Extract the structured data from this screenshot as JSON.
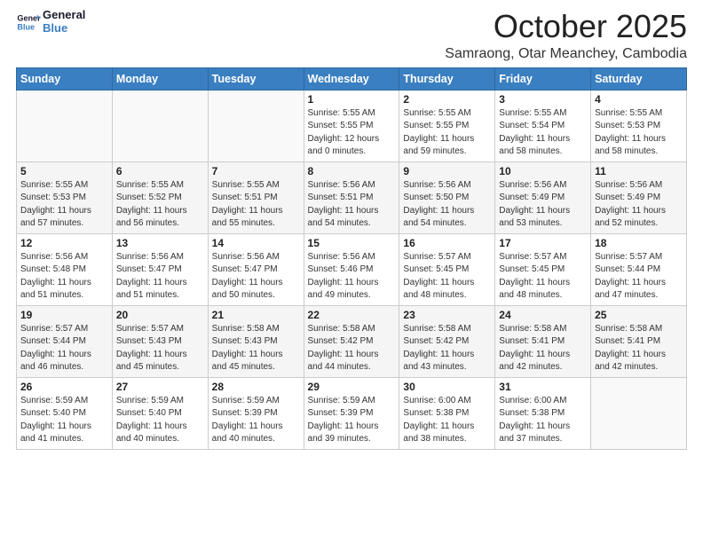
{
  "header": {
    "logo_line1": "General",
    "logo_line2": "Blue",
    "month": "October 2025",
    "location": "Samraong, Otar Meanchey, Cambodia"
  },
  "days_of_week": [
    "Sunday",
    "Monday",
    "Tuesday",
    "Wednesday",
    "Thursday",
    "Friday",
    "Saturday"
  ],
  "weeks": [
    [
      {
        "day": "",
        "sunrise": "",
        "sunset": "",
        "daylight": ""
      },
      {
        "day": "",
        "sunrise": "",
        "sunset": "",
        "daylight": ""
      },
      {
        "day": "",
        "sunrise": "",
        "sunset": "",
        "daylight": ""
      },
      {
        "day": "1",
        "sunrise": "5:55 AM",
        "sunset": "5:55 PM",
        "daylight": "12 hours and 0 minutes."
      },
      {
        "day": "2",
        "sunrise": "5:55 AM",
        "sunset": "5:55 PM",
        "daylight": "11 hours and 59 minutes."
      },
      {
        "day": "3",
        "sunrise": "5:55 AM",
        "sunset": "5:54 PM",
        "daylight": "11 hours and 58 minutes."
      },
      {
        "day": "4",
        "sunrise": "5:55 AM",
        "sunset": "5:53 PM",
        "daylight": "11 hours and 58 minutes."
      }
    ],
    [
      {
        "day": "5",
        "sunrise": "5:55 AM",
        "sunset": "5:53 PM",
        "daylight": "11 hours and 57 minutes."
      },
      {
        "day": "6",
        "sunrise": "5:55 AM",
        "sunset": "5:52 PM",
        "daylight": "11 hours and 56 minutes."
      },
      {
        "day": "7",
        "sunrise": "5:55 AM",
        "sunset": "5:51 PM",
        "daylight": "11 hours and 55 minutes."
      },
      {
        "day": "8",
        "sunrise": "5:56 AM",
        "sunset": "5:51 PM",
        "daylight": "11 hours and 54 minutes."
      },
      {
        "day": "9",
        "sunrise": "5:56 AM",
        "sunset": "5:50 PM",
        "daylight": "11 hours and 54 minutes."
      },
      {
        "day": "10",
        "sunrise": "5:56 AM",
        "sunset": "5:49 PM",
        "daylight": "11 hours and 53 minutes."
      },
      {
        "day": "11",
        "sunrise": "5:56 AM",
        "sunset": "5:49 PM",
        "daylight": "11 hours and 52 minutes."
      }
    ],
    [
      {
        "day": "12",
        "sunrise": "5:56 AM",
        "sunset": "5:48 PM",
        "daylight": "11 hours and 51 minutes."
      },
      {
        "day": "13",
        "sunrise": "5:56 AM",
        "sunset": "5:47 PM",
        "daylight": "11 hours and 51 minutes."
      },
      {
        "day": "14",
        "sunrise": "5:56 AM",
        "sunset": "5:47 PM",
        "daylight": "11 hours and 50 minutes."
      },
      {
        "day": "15",
        "sunrise": "5:56 AM",
        "sunset": "5:46 PM",
        "daylight": "11 hours and 49 minutes."
      },
      {
        "day": "16",
        "sunrise": "5:57 AM",
        "sunset": "5:45 PM",
        "daylight": "11 hours and 48 minutes."
      },
      {
        "day": "17",
        "sunrise": "5:57 AM",
        "sunset": "5:45 PM",
        "daylight": "11 hours and 48 minutes."
      },
      {
        "day": "18",
        "sunrise": "5:57 AM",
        "sunset": "5:44 PM",
        "daylight": "11 hours and 47 minutes."
      }
    ],
    [
      {
        "day": "19",
        "sunrise": "5:57 AM",
        "sunset": "5:44 PM",
        "daylight": "11 hours and 46 minutes."
      },
      {
        "day": "20",
        "sunrise": "5:57 AM",
        "sunset": "5:43 PM",
        "daylight": "11 hours and 45 minutes."
      },
      {
        "day": "21",
        "sunrise": "5:58 AM",
        "sunset": "5:43 PM",
        "daylight": "11 hours and 45 minutes."
      },
      {
        "day": "22",
        "sunrise": "5:58 AM",
        "sunset": "5:42 PM",
        "daylight": "11 hours and 44 minutes."
      },
      {
        "day": "23",
        "sunrise": "5:58 AM",
        "sunset": "5:42 PM",
        "daylight": "11 hours and 43 minutes."
      },
      {
        "day": "24",
        "sunrise": "5:58 AM",
        "sunset": "5:41 PM",
        "daylight": "11 hours and 42 minutes."
      },
      {
        "day": "25",
        "sunrise": "5:58 AM",
        "sunset": "5:41 PM",
        "daylight": "11 hours and 42 minutes."
      }
    ],
    [
      {
        "day": "26",
        "sunrise": "5:59 AM",
        "sunset": "5:40 PM",
        "daylight": "11 hours and 41 minutes."
      },
      {
        "day": "27",
        "sunrise": "5:59 AM",
        "sunset": "5:40 PM",
        "daylight": "11 hours and 40 minutes."
      },
      {
        "day": "28",
        "sunrise": "5:59 AM",
        "sunset": "5:39 PM",
        "daylight": "11 hours and 40 minutes."
      },
      {
        "day": "29",
        "sunrise": "5:59 AM",
        "sunset": "5:39 PM",
        "daylight": "11 hours and 39 minutes."
      },
      {
        "day": "30",
        "sunrise": "6:00 AM",
        "sunset": "5:38 PM",
        "daylight": "11 hours and 38 minutes."
      },
      {
        "day": "31",
        "sunrise": "6:00 AM",
        "sunset": "5:38 PM",
        "daylight": "11 hours and 37 minutes."
      },
      {
        "day": "",
        "sunrise": "",
        "sunset": "",
        "daylight": ""
      }
    ]
  ]
}
